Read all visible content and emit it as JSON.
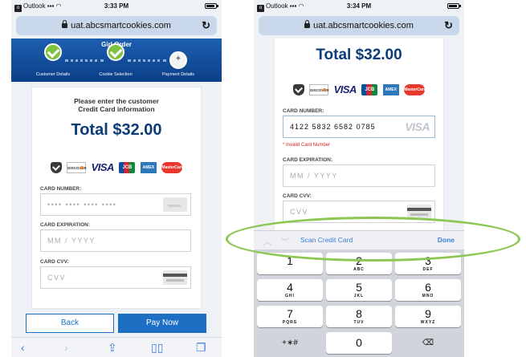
{
  "left": {
    "status": {
      "carrier": "Outlook",
      "time": "3:33 PM"
    },
    "url": "uat.abcsmartcookies.com",
    "progress": {
      "title": "Girl Order",
      "steps": [
        "Customer Details",
        "Cookie Selection",
        "Payment Details"
      ]
    },
    "prompt_line1": "Please enter the customer",
    "prompt_line2": "Credit Card information",
    "total": "Total $32.00",
    "brands": {
      "discover": "DISCOVER",
      "visa": "VISA",
      "jcb": "JCB",
      "amex": "AMEX",
      "mastercard": "MasterCard"
    },
    "card_number_label": "CARD NUMBER:",
    "card_number_placeholder": "•••• •••• •••• ••••",
    "expiration_label": "CARD EXPIRATION:",
    "expiration_placeholder": "MM / YYYY",
    "cvv_label": "CARD CVV:",
    "cvv_placeholder": "CVV",
    "back_label": "Back",
    "pay_label": "Pay Now",
    "toolbar": {
      "back": "‹",
      "forward": "›",
      "share": "⇪",
      "bookmarks": "▯▯",
      "tabs": "❐"
    }
  },
  "right": {
    "status": {
      "carrier": "Outlook",
      "time": "3:34 PM"
    },
    "url": "uat.abcsmartcookies.com",
    "total": "Total $32.00",
    "card_number_label": "CARD NUMBER:",
    "card_number_value": "4122 5832 6582 0785",
    "card_brand_hint": "VISA",
    "invalid_message": "* Invalid Card Number",
    "expiration_label": "CARD EXPIRATION:",
    "expiration_placeholder": "MM / YYYY",
    "cvv_label": "CARD CVV:",
    "cvv_placeholder": "CVV",
    "scan_label": "Scan Credit Card",
    "done_label": "Done",
    "keys": [
      {
        "num": "1",
        "letters": ""
      },
      {
        "num": "2",
        "letters": "ABC"
      },
      {
        "num": "3",
        "letters": "DEF"
      },
      {
        "num": "4",
        "letters": "GHI"
      },
      {
        "num": "5",
        "letters": "JKL"
      },
      {
        "num": "6",
        "letters": "MNO"
      },
      {
        "num": "7",
        "letters": "PQRS"
      },
      {
        "num": "8",
        "letters": "TUV"
      },
      {
        "num": "9",
        "letters": "WXYZ"
      },
      {
        "num": "+∗#",
        "letters": ""
      },
      {
        "num": "0",
        "letters": ""
      },
      {
        "num": "⌫",
        "letters": ""
      }
    ]
  },
  "colors": {
    "brand_blue": "#0b3b78",
    "button_blue": "#1d6fc4",
    "highlight_green": "#8dc753",
    "error_red": "#d32424"
  }
}
